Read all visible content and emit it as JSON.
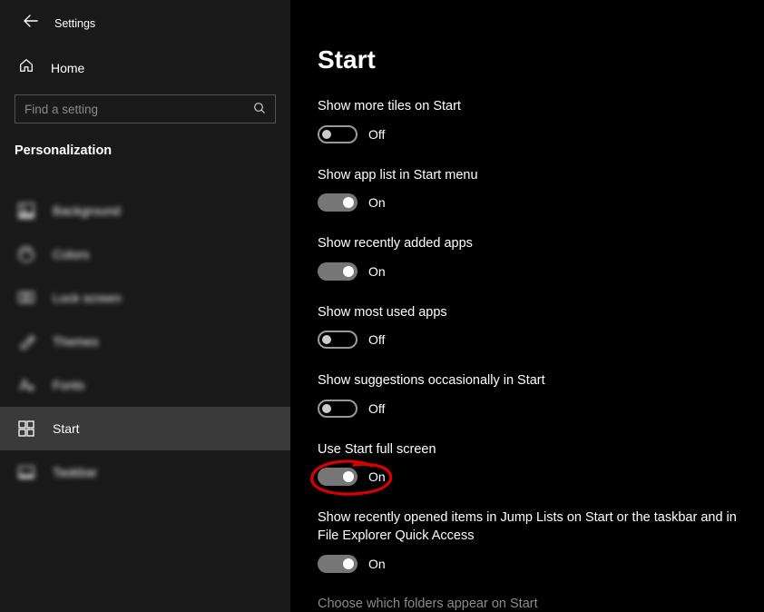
{
  "app_title": "Settings",
  "home_label": "Home",
  "search_placeholder": "Find a setting",
  "section_title": "Personalization",
  "nav": [
    {
      "label": "Background"
    },
    {
      "label": "Colors"
    },
    {
      "label": "Lock screen"
    },
    {
      "label": "Themes"
    },
    {
      "label": "Fonts"
    },
    {
      "label": "Start"
    },
    {
      "label": "Taskbar"
    }
  ],
  "page_title": "Start",
  "settings": [
    {
      "label": "Show more tiles on Start",
      "state": "off",
      "state_text": "Off"
    },
    {
      "label": "Show app list in Start menu",
      "state": "on",
      "state_text": "On"
    },
    {
      "label": "Show recently added apps",
      "state": "on",
      "state_text": "On"
    },
    {
      "label": "Show most used apps",
      "state": "off",
      "state_text": "Off"
    },
    {
      "label": "Show suggestions occasionally in Start",
      "state": "off",
      "state_text": "Off"
    },
    {
      "label": "Use Start full screen",
      "state": "on",
      "state_text": "On"
    },
    {
      "label": "Show recently opened items in Jump Lists on Start or the taskbar and in File Explorer Quick Access",
      "state": "on",
      "state_text": "On"
    }
  ],
  "link_text": "Choose which folders appear on Start"
}
